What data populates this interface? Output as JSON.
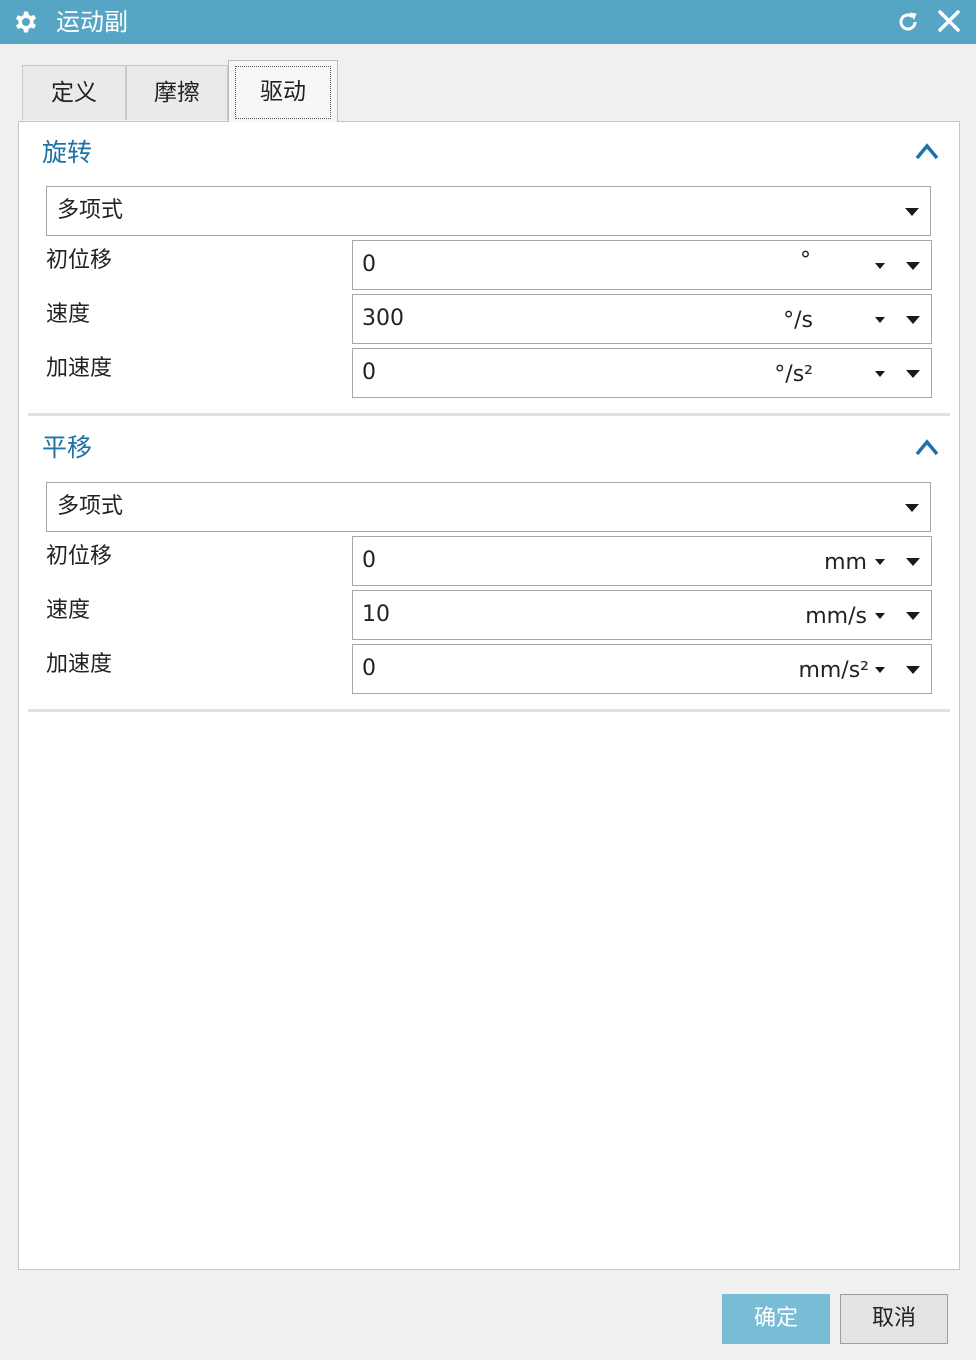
{
  "window": {
    "title": "运动副",
    "title_icon": "gear-icon",
    "reset_icon": "reset-icon",
    "close_icon": "close-icon",
    "accent_color": "#57a5c4"
  },
  "tabs": [
    {
      "label": "定义",
      "active": false
    },
    {
      "label": "摩擦",
      "active": false
    },
    {
      "label": "驱动",
      "active": true
    }
  ],
  "rotation": {
    "title": "旋转",
    "mode": "多项式",
    "rows": [
      {
        "label": "初位移",
        "value": "0",
        "unit": "°"
      },
      {
        "label": "速度",
        "value": "300",
        "unit": "°/s"
      },
      {
        "label": "加速度",
        "value": "0",
        "unit": "°/s²"
      }
    ]
  },
  "translation": {
    "title": "平移",
    "mode": "多项式",
    "rows": [
      {
        "label": "初位移",
        "value": "0",
        "unit": "mm"
      },
      {
        "label": "速度",
        "value": "10",
        "unit": "mm/s"
      },
      {
        "label": "加速度",
        "value": "0",
        "unit": "mm/s²"
      }
    ]
  },
  "buttons": {
    "ok": "确定",
    "cancel": "取消"
  }
}
